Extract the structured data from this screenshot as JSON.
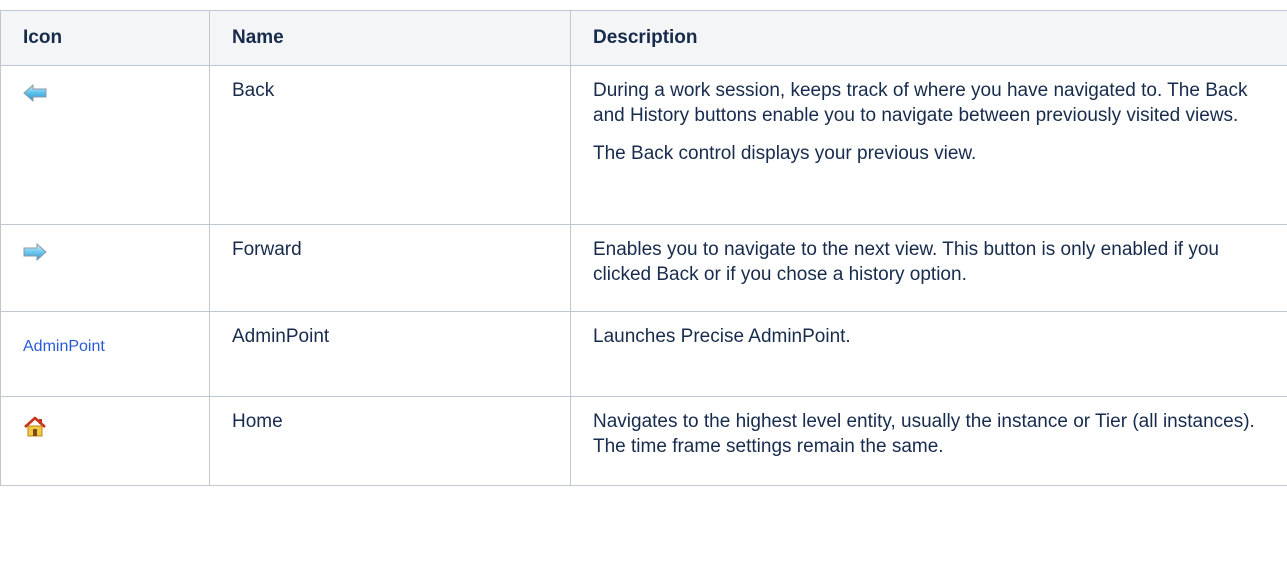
{
  "table": {
    "headers": {
      "icon": "Icon",
      "name": "Name",
      "description": "Description"
    },
    "rows": [
      {
        "icon": "back-arrow-icon",
        "name": "Back",
        "description": [
          "During a work session, keeps track of where you have navigated to. The Back and History buttons enable you to navigate between previously visited views.",
          "The Back control displays your previous view."
        ]
      },
      {
        "icon": "forward-arrow-icon",
        "name": "Forward",
        "description": [
          "Enables you to navigate to the next view. This button is only enabled if you clicked Back or if you chose a history option."
        ]
      },
      {
        "icon": "adminpoint-link",
        "icon_text": "AdminPoint",
        "name": "AdminPoint",
        "description": [
          "Launches Precise AdminPoint."
        ]
      },
      {
        "icon": "home-icon",
        "name": "Home",
        "description": [
          "Navigates to the highest level entity, usually the instance or Tier (all instances). The time frame settings remain the same."
        ]
      }
    ]
  },
  "colors": {
    "header_bg": "#f4f5f7",
    "border": "#c1c7d0",
    "text": "#172b4d",
    "link": "#2a5bd7"
  }
}
